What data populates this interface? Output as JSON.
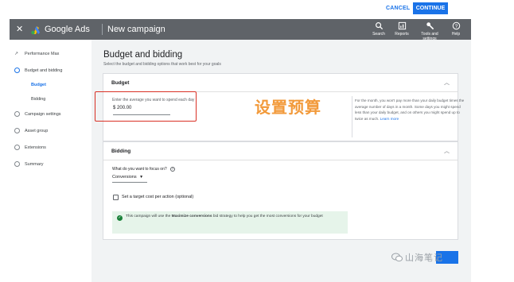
{
  "top_bar": {
    "cancel": "CANCEL",
    "continue": "CONTINUE"
  },
  "app_bar": {
    "close_icon": "close-icon",
    "brand": "Google Ads",
    "title": "New campaign",
    "tools": [
      {
        "label": "Search",
        "icon": "search-icon"
      },
      {
        "label": "Reports",
        "icon": "reports-icon"
      },
      {
        "label": "Tools and settings",
        "icon": "wrench-icon"
      },
      {
        "label": "Help",
        "icon": "help-icon"
      }
    ]
  },
  "sidebar": {
    "items": [
      {
        "label": "Performance Max"
      },
      {
        "label": "Budget and bidding"
      },
      {
        "label": "Budget"
      },
      {
        "label": "Bidding"
      },
      {
        "label": "Campaign settings"
      },
      {
        "label": "Asset group"
      },
      {
        "label": "Extensions"
      },
      {
        "label": "Summary"
      }
    ]
  },
  "main": {
    "title": "Budget and bidding",
    "subtitle": "Select the budget and bidding options that work best for your goals"
  },
  "budget_card": {
    "title": "Budget",
    "field_label": "Enter the average you want to spend each day",
    "currency": "$",
    "amount": "200.00",
    "note": "For the month, you won't pay more than your daily budget times the average number of days in a month. Some days you might spend less than your daily budget, and on others you might spend up to twice as much.",
    "learn_more": "Learn more"
  },
  "overlay_text": "设置预算",
  "bidding_card": {
    "title": "Bidding",
    "question": "What do you want to focus on?",
    "focus_value": "Conversions",
    "checkbox_label": "Set a target cost per action (optional)",
    "info_prefix": "This campaign will use the ",
    "info_strategy": "Maximize conversions",
    "info_suffix": " bid strategy to help you get the most conversions for your budget"
  },
  "watermark": {
    "text": "山海笔记"
  },
  "colors": {
    "accent": "#1a73e8",
    "appbar": "#5f6368",
    "highlight_box": "#d93025",
    "overlay_text": "#f29a3b",
    "info_bg": "#e6f4ea"
  }
}
